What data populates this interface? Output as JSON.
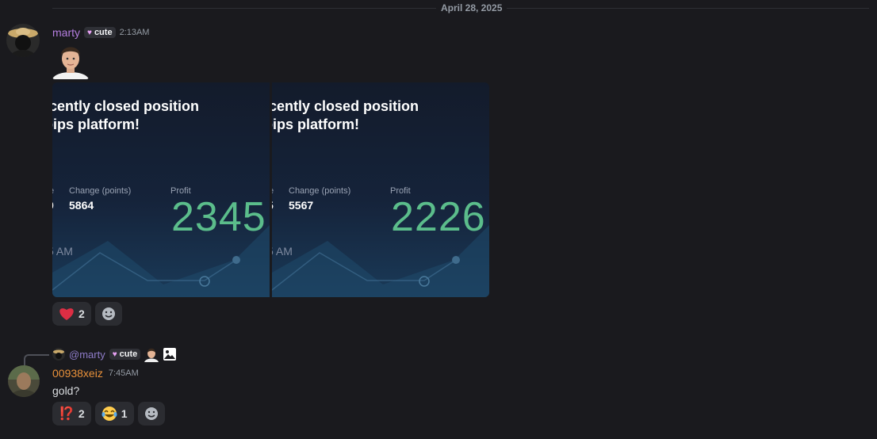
{
  "date_divider": "April 28, 2025",
  "message1": {
    "username": "marty",
    "tag": "cute",
    "timestamp": "2:13AM",
    "cards": [
      {
        "headline_line1": "ecently closed position",
        "headline_line2": "pips platform!",
        "col1_label": "e",
        "col1_value": "9",
        "change_label": "Change (points)",
        "change_value": "5864",
        "profit_label": "Profit",
        "profit_value": "2345",
        "time": "5 AM"
      },
      {
        "headline_line1": "ecently closed position",
        "headline_line2": "pips platform!",
        "col1_label": "e",
        "col1_value": "5",
        "change_label": "Change (points)",
        "change_value": "5567",
        "profit_label": "Profit",
        "profit_value": "2226",
        "time": "5 AM"
      }
    ],
    "reactions": [
      {
        "icon": "red-heart-emoji",
        "count": "2"
      }
    ]
  },
  "message2": {
    "reply": {
      "mention": "@marty",
      "tag": "cute",
      "attachment_icon": "image-icon"
    },
    "username": "00938xeiz",
    "timestamp": "7:45AM",
    "text": "gold?",
    "reactions": [
      {
        "icon": "interrobang-emoji",
        "symbol": "⁉️",
        "count": "2"
      },
      {
        "icon": "tears-of-joy-emoji",
        "symbol": "😂",
        "count": "1"
      }
    ]
  },
  "colors": {
    "background": "#1a1a1e",
    "marty_name": "#b57ee0",
    "xeiz_name": "#e9913a",
    "profit_green": "#5bbd8b"
  }
}
